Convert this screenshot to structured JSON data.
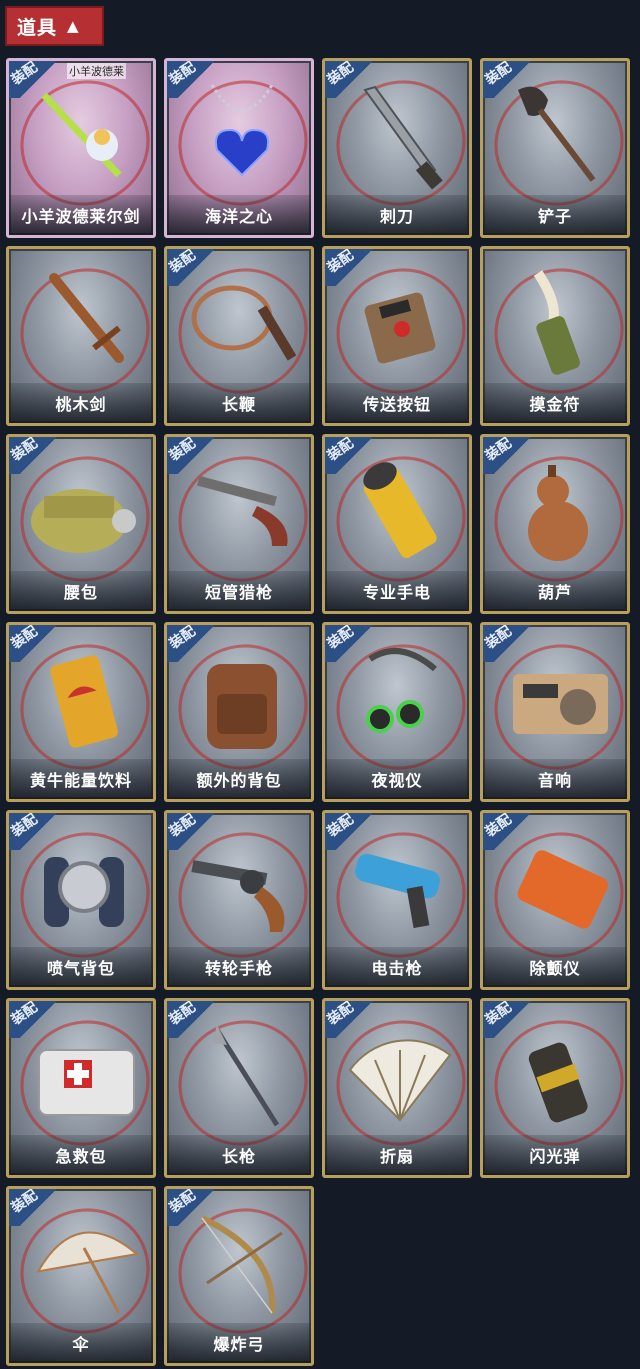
{
  "header": {
    "title": "道具",
    "chevron": "▲"
  },
  "badge_label": "装配",
  "items": [
    {
      "name": "小羊波德莱尔剑",
      "icon": "sword-plush-icon",
      "equipped": true,
      "pink": true,
      "tag": "小羊波德莱"
    },
    {
      "name": "海洋之心",
      "icon": "heart-necklace-icon",
      "equipped": true,
      "pink": true
    },
    {
      "name": "刺刀",
      "icon": "bayonet-icon",
      "equipped": true
    },
    {
      "name": "铲子",
      "icon": "shovel-icon",
      "equipped": true
    },
    {
      "name": "桃木剑",
      "icon": "wooden-sword-icon",
      "equipped": false
    },
    {
      "name": "长鞭",
      "icon": "whip-icon",
      "equipped": true
    },
    {
      "name": "传送按钮",
      "icon": "teleport-button-icon",
      "equipped": true
    },
    {
      "name": "摸金符",
      "icon": "talisman-icon",
      "equipped": false
    },
    {
      "name": "腰包",
      "icon": "waist-bag-icon",
      "equipped": true
    },
    {
      "name": "短管猎枪",
      "icon": "shotgun-icon",
      "equipped": true
    },
    {
      "name": "专业手电",
      "icon": "flashlight-icon",
      "equipped": true
    },
    {
      "name": "葫芦",
      "icon": "gourd-icon",
      "equipped": true
    },
    {
      "name": "黄牛能量饮料",
      "icon": "energy-drink-icon",
      "equipped": true
    },
    {
      "name": "额外的背包",
      "icon": "backpack-icon",
      "equipped": true
    },
    {
      "name": "夜视仪",
      "icon": "night-vision-icon",
      "equipped": true
    },
    {
      "name": "音响",
      "icon": "radio-speaker-icon",
      "equipped": true
    },
    {
      "name": "喷气背包",
      "icon": "jetpack-icon",
      "equipped": true
    },
    {
      "name": "转轮手枪",
      "icon": "revolver-icon",
      "equipped": true
    },
    {
      "name": "电击枪",
      "icon": "taser-gun-icon",
      "equipped": true
    },
    {
      "name": "除颤仪",
      "icon": "defibrillator-icon",
      "equipped": true
    },
    {
      "name": "急救包",
      "icon": "first-aid-kit-icon",
      "equipped": true
    },
    {
      "name": "长枪",
      "icon": "spear-icon",
      "equipped": true
    },
    {
      "name": "折扇",
      "icon": "folding-fan-icon",
      "equipped": true
    },
    {
      "name": "闪光弹",
      "icon": "flash-grenade-icon",
      "equipped": true
    },
    {
      "name": "伞",
      "icon": "umbrella-icon",
      "equipped": true
    },
    {
      "name": "爆炸弓",
      "icon": "explosive-bow-icon",
      "equipped": true
    }
  ],
  "colors": {
    "header_bg": "#b52f33",
    "page_bg": "#141a26",
    "badge_bg": "#2c4f86",
    "frame": "#b8a05a"
  }
}
